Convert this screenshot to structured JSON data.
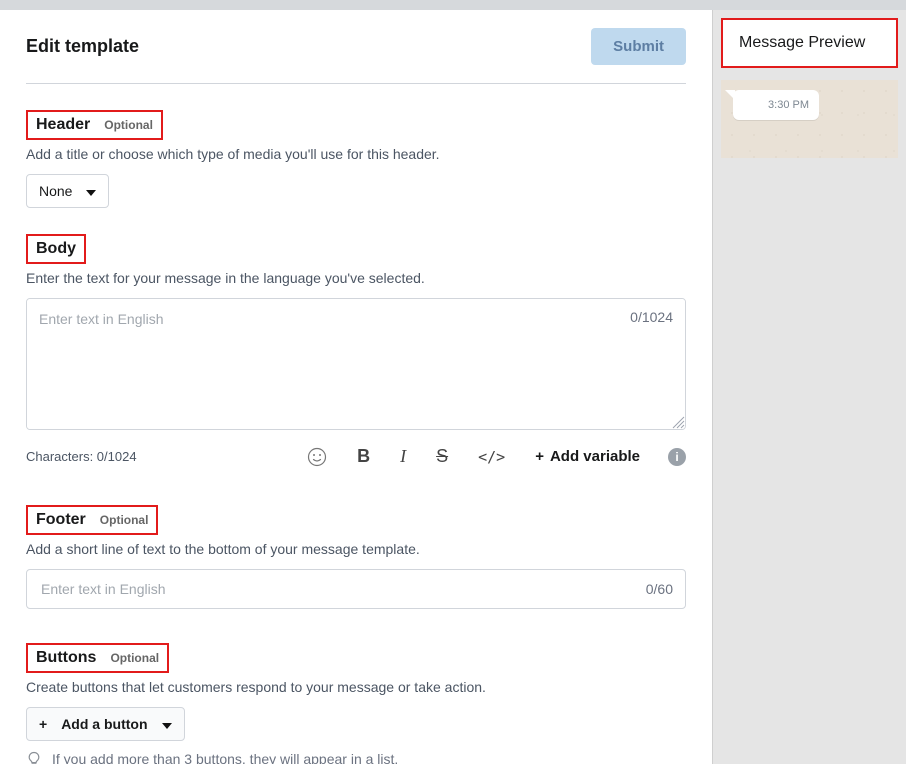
{
  "page": {
    "title": "Edit template",
    "submit_label": "Submit"
  },
  "header": {
    "title": "Header",
    "optional_label": "Optional",
    "desc": "Add a title or choose which type of media you'll use for this header.",
    "dropdown_value": "None"
  },
  "body": {
    "title": "Body",
    "desc": "Enter the text for your message in the language you've selected.",
    "placeholder": "Enter text in English",
    "char_counter_in_box": "0/1024",
    "char_counter_label": "Characters: 0/1024",
    "toolbar": {
      "emoji_icon": "emoji",
      "bold": "B",
      "italic": "I",
      "strike": "S",
      "code": "</>",
      "add_variable": "Add variable"
    }
  },
  "footer": {
    "title": "Footer",
    "optional_label": "Optional",
    "desc": "Add a short line of text to the bottom of your message template.",
    "placeholder": "Enter text in English",
    "counter": "0/60"
  },
  "buttons": {
    "title": "Buttons",
    "optional_label": "Optional",
    "desc": "Create buttons that let customers respond to your message or take action.",
    "add_label": "Add a button",
    "hint": "If you add more than 3 buttons, they will appear in a list."
  },
  "preview": {
    "title": "Message Preview",
    "time": "3:30 PM"
  }
}
